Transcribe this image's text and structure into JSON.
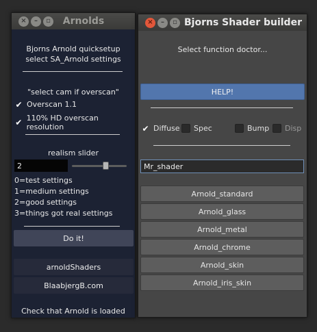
{
  "arnolds": {
    "title": "Arnolds",
    "intro_line1": "Bjorns Arnold quicksetup",
    "intro_line2": "select SA_Arnold settings",
    "overscan_note": "\"select cam if overscan\"",
    "overscan_label": "Overscan 1.1",
    "overscan_checked": true,
    "hd_label": "110% HD overscan resolution",
    "hd_checked": true,
    "slider_label": "realism slider",
    "slider_value": "2",
    "slider_fraction": 0.63,
    "legend": [
      "0=test settings",
      "1=medium settings",
      "2=good settings",
      "3=things got real settings"
    ],
    "doit_label": "Do it!",
    "shaders_label": "arnoldShaders",
    "site_label": "BlaabjergB.com",
    "footer": "Check that Arnold is loaded"
  },
  "shader": {
    "title": "Bjorns Shader builder",
    "subtitle": "Select function doctor...",
    "help_label": "HELP!",
    "options": [
      {
        "label": "Diffuse",
        "checked": true
      },
      {
        "label": "Spec",
        "checked": false
      },
      {
        "label": "Bump",
        "checked": false
      },
      {
        "label": "Disp",
        "checked": false
      }
    ],
    "name_value": "Mr_shader",
    "buttons": [
      "Arnold_standard",
      "Arnold_glass",
      "Arnold_metal",
      "Arnold_chrome",
      "Arnold_skin",
      "Arnold_iris_skin"
    ]
  },
  "colors": {
    "left_bg": "#1c2233",
    "right_bg": "#464646",
    "help_accent": "#5276ad",
    "close_button": "#e2573a"
  }
}
